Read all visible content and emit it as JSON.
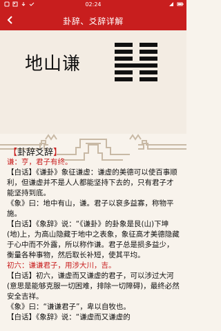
{
  "status": {
    "time": "02:24",
    "left_icons": [
      "notification-icon",
      "image-icon",
      "download-icon",
      "check-icon"
    ],
    "right_icons": [
      "signal-icon",
      "battery-icon"
    ]
  },
  "header": {
    "title": "卦辞、爻辞详解"
  },
  "hexagram": {
    "name": "地山谦",
    "lines": [
      "yin",
      "yin",
      "yin",
      "yang",
      "yin",
      "yin"
    ]
  },
  "section": {
    "title": "卦辞爻辞"
  },
  "paragraphs": [
    {
      "text": "谦：亨，君子有终。",
      "red": true
    },
    {
      "text": "【白话】《谦卦》象征谦虚：谦虚的美德可以使百事顺利，但谦虚并不是人人都能坚持下去的，只有君子才能坚持到底。",
      "red": false
    },
    {
      "text": "《象》曰：地中有山，谦。君子以裒多益寡，称物平施。",
      "red": false
    },
    {
      "text": "【白话】《象辞》说：“《谦卦》的卦象是艮(山)下坤(地)上，为高山隐藏于地中之表象，象征高才美德隐藏于心中而不外露，所以称作谦。君子总是损多益少，衡量各种事物，然后取长补短，使其平均。",
      "red": false
    },
    {
      "text": "初六：谦谦君子，用涉大川，吉。",
      "red": true
    },
    {
      "text": "【白话】初六，谦虚而又谦虚的君子，可以涉过大河(意思是能够克服一切困难，排除一切障碍)，最终必然安全吉祥。",
      "red": false
    },
    {
      "text": "《象》曰：“谦谦君子”，卑以自牧也。",
      "red": false
    },
    {
      "text": "【白话】《象辞》说：“谦虚而又谦虚的",
      "red": false
    }
  ]
}
